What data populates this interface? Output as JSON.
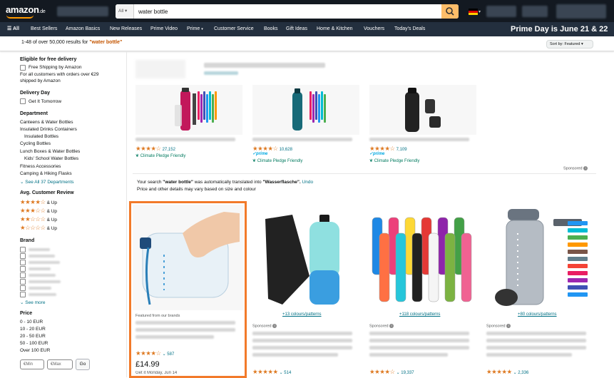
{
  "header": {
    "logo_text": "amazon",
    "logo_tld": ".de",
    "search_category": "All",
    "search_value": "water bottle"
  },
  "nav": {
    "all_label": "All",
    "items": [
      "Best Sellers",
      "Amazon Basics",
      "New Releases",
      "Prime Video",
      "Prime",
      "Customer Service",
      "Books",
      "Gift Ideas",
      "Home & Kitchen",
      "Vouchers",
      "Today's Deals"
    ],
    "promo": "Prime Day is June 21 & 22"
  },
  "results": {
    "prefix": "1-48 of over 50,000 results for",
    "query": "\"water bottle\"",
    "sort_label": "Sort by: Featured"
  },
  "sidebar": {
    "delivery_heading": "Eligible for free delivery",
    "free_shipping": "Free Shipping by Amazon",
    "free_shipping_note_1": "For all customers with orders over €29",
    "free_shipping_note_2": "shipped by Amazon",
    "delivery_day_heading": "Delivery Day",
    "get_it_tomorrow": "Get It Tomorrow",
    "department_heading": "Department",
    "departments": [
      "Canteens & Water Bottles",
      "Insulated Drinks Containers",
      "Insulated Bottles",
      "Cycling Bottles",
      "Lunch Boxes & Water Bottles",
      "Kids' School Water Bottles",
      "Fitness Accessories",
      "Camping & Hiking Flasks"
    ],
    "see_all_departments": "See All 37 Departments",
    "rating_heading": "Avg. Customer Review",
    "rating_rows": [
      {
        "filled": 4,
        "label": "& Up"
      },
      {
        "filled": 3,
        "label": "& Up"
      },
      {
        "filled": 2,
        "label": "& Up"
      },
      {
        "filled": 1,
        "label": "& Up"
      }
    ],
    "brand_heading": "Brand",
    "see_more": "See more",
    "price_heading": "Price",
    "price_ranges": [
      "0 - 10 EUR",
      "10 - 20 EUR",
      "20 - 50 EUR",
      "50 - 100 EUR",
      "Over 100 EUR"
    ],
    "min_placeholder": "€Min",
    "max_placeholder": "€Max",
    "go_label": "Go"
  },
  "sponsored_top": {
    "products": [
      {
        "rating_count": "27,152",
        "badge": "Climate Pledge Friendly",
        "prime": false
      },
      {
        "rating_count": "10,628",
        "badge": "Climate Pledge Friendly",
        "prime": true
      },
      {
        "rating_count": "7,109",
        "badge": "Climate Pledge Friendly",
        "prime": true
      }
    ],
    "sponsored_label": "Sponsored"
  },
  "translation_note": {
    "prefix": "Your search",
    "query": "\"water bottle\"",
    "middle": "was automatically translated into",
    "translated": "\"Wasserflasche\".",
    "undo": "Undo",
    "line2": "Price and other details may vary based on size and colour"
  },
  "grid": {
    "products": [
      {
        "label_top": "Featured from our brands",
        "rating_count": "587",
        "price": "£14.99",
        "delivery": "Get it Monday, Jun 14",
        "swatches": ""
      },
      {
        "label_top": "Sponsored",
        "rating_count": "514",
        "price": "",
        "delivery": "",
        "swatches": "+13 colours/patterns"
      },
      {
        "label_top": "Sponsored",
        "rating_count": "19,337",
        "price": "",
        "delivery": "",
        "swatches": "+118 colours/patterns"
      },
      {
        "label_top": "Sponsored",
        "rating_count": "2,336",
        "price": "",
        "delivery": "",
        "swatches": "+80 colours/patterns"
      }
    ]
  },
  "colors": {
    "header_bg": "#131921",
    "nav_bg": "#232f3e",
    "accent": "#febd69",
    "star": "#de7921",
    "link": "#007185",
    "highlight": "#f27a2a"
  }
}
